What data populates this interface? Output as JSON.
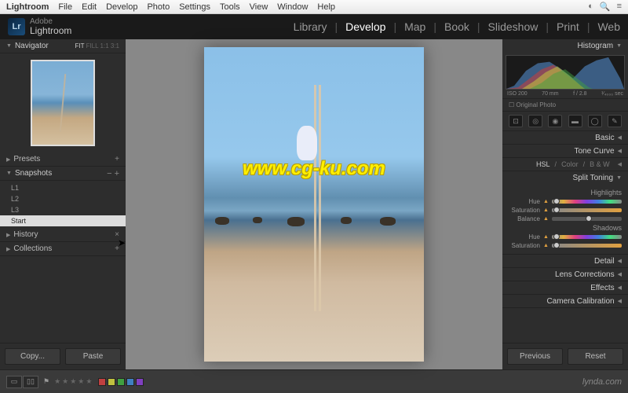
{
  "menubar": {
    "app": "Lightroom",
    "items": [
      "File",
      "Edit",
      "Develop",
      "Photo",
      "Settings",
      "Tools",
      "View",
      "Window",
      "Help"
    ]
  },
  "brand": {
    "adobe": "Adobe",
    "name": "Lightroom",
    "icon": "Lr"
  },
  "modules": {
    "items": [
      "Library",
      "Develop",
      "Map",
      "Book",
      "Slideshow",
      "Print",
      "Web"
    ],
    "active": "Develop"
  },
  "left": {
    "navigator": {
      "title": "Navigator",
      "opts": [
        "FIT",
        "FILL",
        "1:1",
        "3:1"
      ],
      "selected": "FIT"
    },
    "presets": {
      "title": "Presets"
    },
    "snapshots": {
      "title": "Snapshots",
      "items": [
        "L1",
        "L2",
        "L3",
        "Start"
      ],
      "selected": "Start"
    },
    "history": {
      "title": "History"
    },
    "collections": {
      "title": "Collections"
    },
    "copy": "Copy...",
    "paste": "Paste"
  },
  "right": {
    "histogram": {
      "title": "Histogram",
      "iso": "ISO 200",
      "focal": "70 mm",
      "aperture": "f / 2.8",
      "shutter": "¹⁄₄₀₀₀ sec",
      "original": "Original Photo"
    },
    "panels": {
      "basic": "Basic",
      "tonecurve": "Tone Curve",
      "hsl": {
        "tabs": [
          "HSL",
          "Color",
          "B & W"
        ],
        "active": "HSL"
      },
      "splittoning": {
        "title": "Split Toning",
        "highlights": "Highlights",
        "shadows": "Shadows",
        "hue": "Hue",
        "saturation": "Saturation",
        "balance": "Balance"
      },
      "detail": "Detail",
      "lens": "Lens Corrections",
      "effects": "Effects",
      "calibration": "Camera Calibration"
    },
    "previous": "Previous",
    "reset": "Reset"
  },
  "toolbar": {
    "flagtip": "",
    "stars": "★★★★★",
    "colors": [
      "#c04040",
      "#c0c040",
      "#40a040",
      "#4080c0",
      "#8040c0"
    ],
    "lynda": "lynda.com"
  },
  "watermark": "www.cg-ku.com"
}
